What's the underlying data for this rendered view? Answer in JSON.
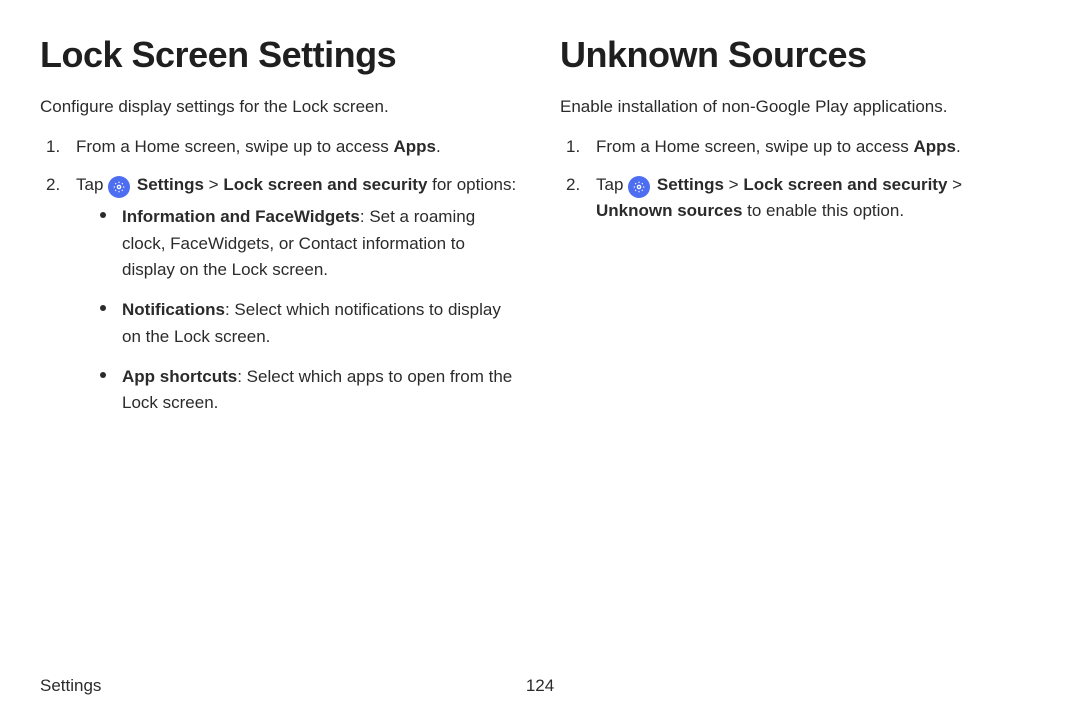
{
  "left": {
    "title": "Lock Screen Settings",
    "intro": "Configure display settings for the Lock screen.",
    "step1_num": "1.",
    "step1_a": "From a Home screen, swipe up to access ",
    "step1_b": "Apps",
    "step1_c": ".",
    "step2_num": "2.",
    "step2_a": "Tap ",
    "step2_b": "Settings",
    "step2_c": " > ",
    "step2_d": "Lock screen and security",
    "step2_e": " for options:",
    "bullet1_a": "Information and FaceWidgets",
    "bullet1_b": ": Set a roaming clock, FaceWidgets, or Contact information to display on the Lock screen.",
    "bullet2_a": "Notifications",
    "bullet2_b": ": Select which notifications to display on the Lock screen.",
    "bullet3_a": "App shortcuts",
    "bullet3_b": ": Select which apps to open from the Lock screen."
  },
  "right": {
    "title": "Unknown Sources",
    "intro": "Enable installation of non-Google Play applications.",
    "step1_num": "1.",
    "step1_a": "From a Home screen, swipe up to access ",
    "step1_b": "Apps",
    "step1_c": ".",
    "step2_num": "2.",
    "step2_a": "Tap ",
    "step2_b": "Settings",
    "step2_c": " > ",
    "step2_d": "Lock screen and security",
    "step2_e": " > ",
    "step2_f": "Unknown sources",
    "step2_g": " to enable this option."
  },
  "footer": {
    "section": "Settings",
    "page": "124"
  }
}
